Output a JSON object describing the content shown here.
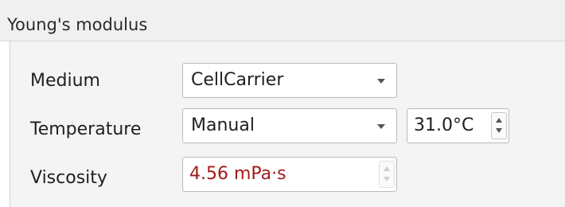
{
  "group": {
    "title": "Young's modulus"
  },
  "rows": {
    "medium": {
      "label": "Medium",
      "selected": "CellCarrier"
    },
    "temperature": {
      "label": "Temperature",
      "mode": "Manual",
      "value": "31.0°C"
    },
    "viscosity": {
      "label": "Viscosity",
      "value": "4.56 mPa·s"
    }
  },
  "colors": {
    "viscosity_text": "#a11a1a",
    "header_bg": "#f0f0f0",
    "panel_bg": "#f4f4f4"
  }
}
